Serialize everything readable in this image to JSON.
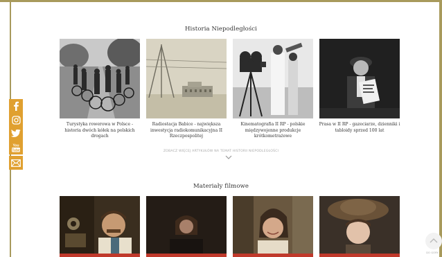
{
  "sections": {
    "history": {
      "title": "Historia Niepodległości",
      "articles": [
        {
          "caption": "Turystyka rowerowa w Polsce - historia dwóch kółek na polskich drogach"
        },
        {
          "caption": "Radiostacja Babice - największa inwestycja radiokomunikacyjna II Rzeczpospolitej"
        },
        {
          "caption": "Kinematografia II RP - polskie międzywojenne produkcje krótkometrażowe"
        },
        {
          "caption": "Prasa w II RP - gazeciarze, dzienniki i tabloidy sprzed 100 lat"
        }
      ],
      "more_link": "ZOBACZ WIĘCEJ ARTYKUŁÓW NA TEMAT HISTORII NIEPODLEGŁOŚCI"
    },
    "films": {
      "title": "Materiały filmowe"
    }
  },
  "social": [
    {
      "icon": "facebook-icon"
    },
    {
      "icon": "instagram-icon"
    },
    {
      "icon": "twitter-icon"
    },
    {
      "icon": "youtube-icon",
      "text": "You Tube"
    },
    {
      "icon": "mail-icon"
    }
  ],
  "scroll_top": {
    "label": "DO GÓRY"
  },
  "colors": {
    "frame": "#a89a5c",
    "social": "#e0a030",
    "accent_red": "#c0392b"
  }
}
